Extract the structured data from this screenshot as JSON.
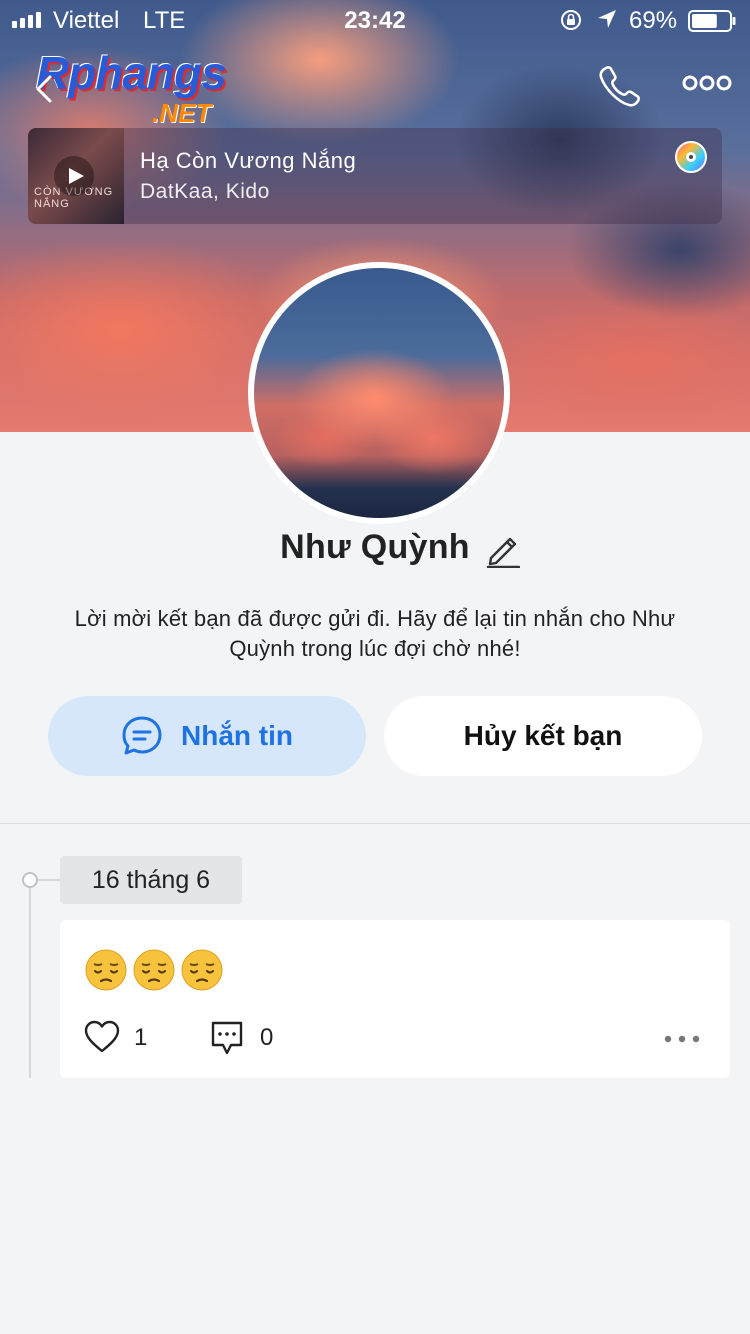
{
  "status_bar": {
    "carrier": "Viettel",
    "network": "LTE",
    "time": "23:42",
    "battery": "69%",
    "battery_level": 0.69
  },
  "watermark": {
    "main": "Rphangs",
    "sub": ".NET"
  },
  "header": {
    "back_icon": "chevron-left-icon",
    "call_icon": "phone-icon",
    "more_icon": "more-horizontal-icon"
  },
  "music": {
    "title": "Hạ Còn Vương Nắng",
    "artist": "DatKaa, Kido",
    "thumb_text": "CÒN VƯƠNG NẮNG"
  },
  "profile": {
    "name": "Như Quỳnh",
    "note": "Lời mời kết bạn đã được gửi đi. Hãy để lại tin nhắn cho Như Quỳnh trong lúc đợi chờ nhé!"
  },
  "actions": {
    "message_label": "Nhắn tin",
    "unfriend_label": "Hủy kết bạn"
  },
  "timeline": {
    "date": "16 tháng 6",
    "post": {
      "emojis": [
        "pensive-face",
        "pensive-face",
        "pensive-face"
      ],
      "likes": "1",
      "comments": "0"
    }
  },
  "colors": {
    "accent_blue": "#1e73e0",
    "message_button_bg": "#d6e7fb",
    "page_bg": "#f3f4f6"
  }
}
